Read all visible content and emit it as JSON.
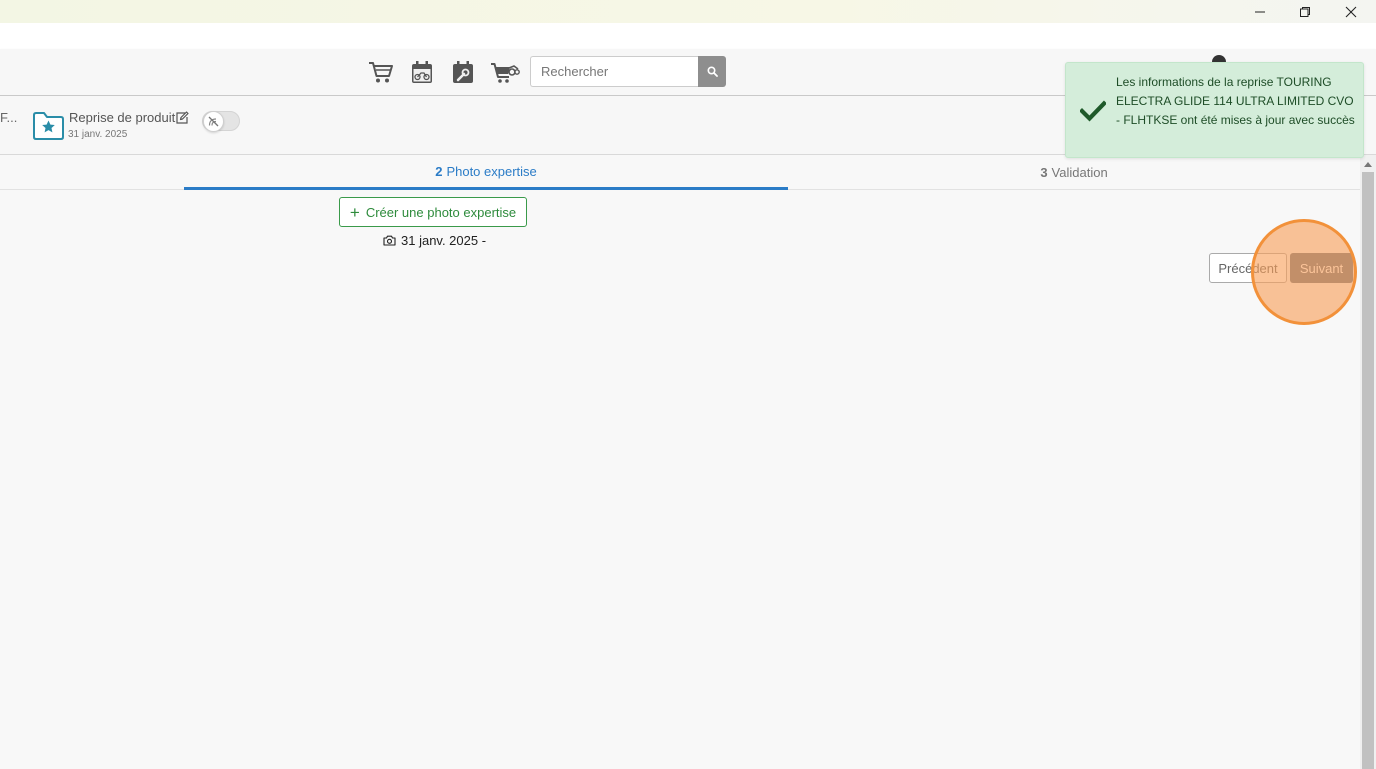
{
  "window": {
    "minimize_icon": "minimize-icon",
    "maximize_icon": "restore-icon",
    "close_icon": "close-icon"
  },
  "header": {
    "icons": [
      "cart-icon",
      "motorcycle-calendar-icon",
      "wrench-calendar-icon",
      "motorcycle-cart-icon"
    ],
    "search": {
      "placeholder": "Rechercher",
      "value": ""
    },
    "search_button_icon": "search-icon"
  },
  "subheader": {
    "truncated_text": "F...",
    "doc_icon": "star-folder-icon",
    "doc_title": "Reprise de produit",
    "doc_date": "31 janv. 2025",
    "edit_icon": "edit-icon",
    "toggle_icon": "no-signal-icon"
  },
  "steps": [
    {
      "number": "2",
      "label": "Photo expertise",
      "active": true
    },
    {
      "number": "3",
      "label": "Validation",
      "active": false
    }
  ],
  "main": {
    "create_button_label": "Créer une photo expertise",
    "photo_entry": "31 janv. 2025 -",
    "prev_label": "Précédent",
    "next_label": "Suivant"
  },
  "toast": {
    "message": "Les informations de la reprise TOURING ELECTRA GLIDE 114 ULTRA LIMITED CVO - FLHTKSE ont été mises à jour avec succès",
    "icon": "checkmark-icon"
  },
  "colors": {
    "accent_blue": "#2b7cc7",
    "success_green": "#2e8b3c",
    "toast_bg": "#d4edda",
    "next_button": "#6b7381",
    "click_marker": "#f2913a"
  }
}
